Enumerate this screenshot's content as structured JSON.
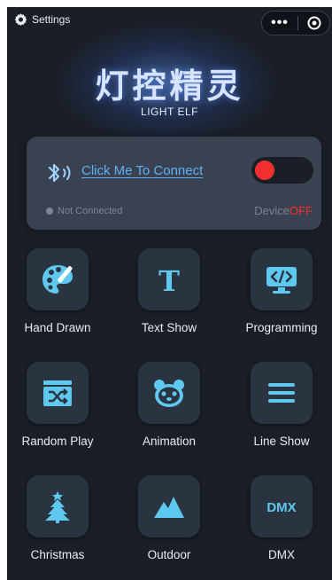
{
  "topbar": {
    "settings_label": "Settings",
    "settings_icon": "gear-icon",
    "more_icon": "more-dots-icon",
    "close_icon": "target-circle-icon"
  },
  "hero": {
    "title": "灯控精灵",
    "subtitle": "LIGHT ELF"
  },
  "connection": {
    "bluetooth_icon": "bluetooth-icon",
    "connect_label": "Click Me To Connect",
    "status_text": "Not Connected",
    "device_label": "Device",
    "device_state": "OFF",
    "toggle_on": false
  },
  "functions": [
    {
      "label": "Hand Drawn",
      "icon": "palette-icon"
    },
    {
      "label": "Text Show",
      "icon": "text-t-icon"
    },
    {
      "label": "Programming",
      "icon": "code-monitor-icon"
    },
    {
      "label": "Random Play",
      "icon": "shuffle-icon"
    },
    {
      "label": "Animation",
      "icon": "panda-icon"
    },
    {
      "label": "Line Show",
      "icon": "lines-icon"
    },
    {
      "label": "Christmas",
      "icon": "christmas-tree-icon"
    },
    {
      "label": "Outdoor",
      "icon": "mountain-icon"
    },
    {
      "label": "DMX",
      "icon": "dmx-icon",
      "icon_text": "DMX"
    }
  ],
  "colors": {
    "background": "#1a1e26",
    "card": "#3a4150",
    "tile": "#2a3340",
    "accent_icon": "#5ec8ee",
    "link": "#5db2f5",
    "off_red": "#ff2e2e"
  }
}
